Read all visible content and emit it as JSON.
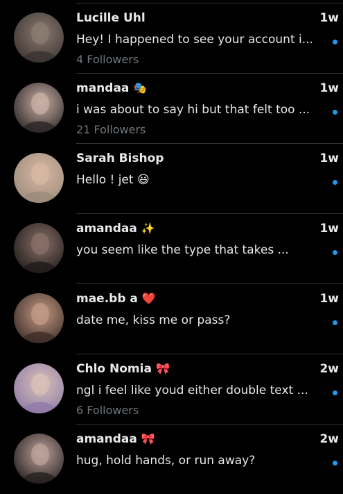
{
  "conversations": [
    {
      "name": "Lucille Uhl",
      "badge": "",
      "time": "1w",
      "preview": "Hey! I happened to see your account i...",
      "followers": "4 Followers",
      "unread": true,
      "avatar_colors": [
        "#3a3230",
        "#8c7c72"
      ]
    },
    {
      "name": "mandaa",
      "badge": "🎭",
      "time": "1w",
      "preview": "i was about to say hi but that felt too ...",
      "followers": "21 Followers",
      "unread": true,
      "avatar_colors": [
        "#2b2424",
        "#c8b0a5"
      ]
    },
    {
      "name": "Sarah Bishop",
      "badge": "",
      "time": "1w",
      "preview": "Hello !   jet 😃",
      "followers": "",
      "unread": true,
      "avatar_colors": [
        "#9b8b7c",
        "#d8b8a2"
      ]
    },
    {
      "name": "amandaa",
      "badge": "✨",
      "time": "1w",
      "preview": "you seem like the type that takes ...",
      "followers": "",
      "unread": true,
      "avatar_colors": [
        "#1f1a1a",
        "#8a7068"
      ]
    },
    {
      "name": "mae.bb a",
      "badge": "❤️",
      "time": "1w",
      "preview": "date me, kiss me or pass?",
      "followers": "",
      "unread": true,
      "avatar_colors": [
        "#3c2c26",
        "#c39a86"
      ]
    },
    {
      "name": "Chlo Nomia",
      "badge": "🎀",
      "time": "2w",
      "preview": "ngl i feel like youd either double text ...",
      "followers": "6 Followers",
      "unread": true,
      "avatar_colors": [
        "#8e7aa9",
        "#d9c2b5"
      ]
    },
    {
      "name": "amandaa",
      "badge": "🎀",
      "time": "2w",
      "preview": "hug, hold hands, or run away?",
      "followers": "",
      "unread": true,
      "avatar_colors": [
        "#231e1e",
        "#bda39a"
      ]
    }
  ],
  "colors": {
    "background": "#000000",
    "divider": "#2f3336",
    "primary_text": "#e7e9ea",
    "secondary_text": "#71767b",
    "unread_dot": "#1d9bf0"
  }
}
